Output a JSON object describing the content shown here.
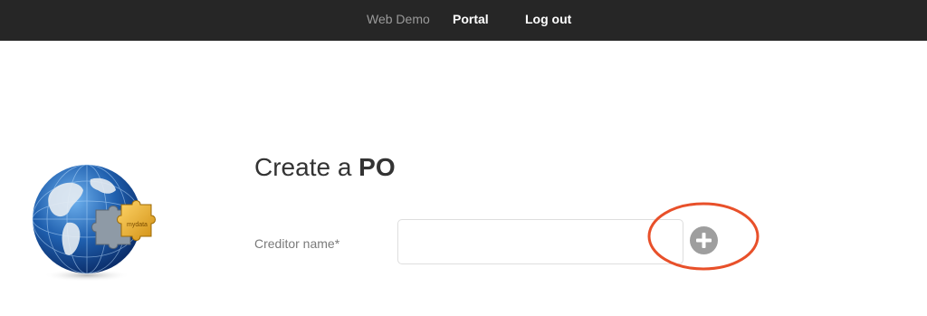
{
  "nav": {
    "brand": "Web Demo",
    "items": [
      {
        "label": "Portal"
      },
      {
        "label": "Log out"
      }
    ]
  },
  "logo": {
    "icon": "globe-puzzle-icon",
    "piece_text": "mydata"
  },
  "form": {
    "title_prefix": "Create a ",
    "title_bold": "PO",
    "creditor": {
      "label": "Creditor name*",
      "value": "",
      "placeholder": ""
    },
    "add_button_icon": "plus-icon"
  },
  "colors": {
    "topbar": "#262626",
    "highlight": "#e8502a",
    "add_button": "#9e9e9e",
    "globe": "#1f5fae"
  }
}
